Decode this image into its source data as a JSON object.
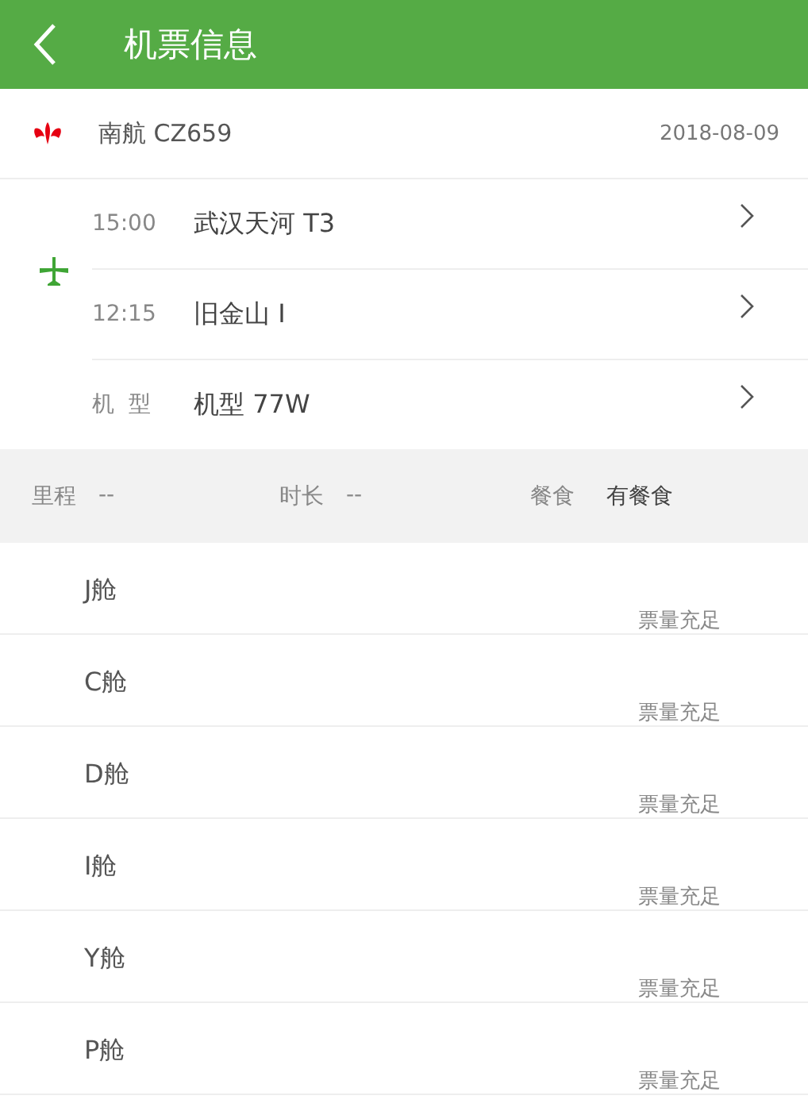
{
  "header": {
    "title": "机票信息"
  },
  "flight": {
    "airline": "南航 CZ659",
    "date": "2018-08-09"
  },
  "route": [
    {
      "label": "15:00",
      "value": "武汉天河 T3"
    },
    {
      "label": "12:15",
      "value": "旧金山 I"
    },
    {
      "label": "机  型",
      "value": "机型 77W"
    }
  ],
  "info": [
    {
      "label": "里程",
      "value": "--"
    },
    {
      "label": "时长",
      "value": "--"
    },
    {
      "label": "餐食",
      "value": "有餐食"
    }
  ],
  "cabins": [
    {
      "name": "J舱",
      "status": "票量充足"
    },
    {
      "name": "C舱",
      "status": "票量充足"
    },
    {
      "name": "D舱",
      "status": "票量充足"
    },
    {
      "name": "I舱",
      "status": "票量充足"
    },
    {
      "name": "Y舱",
      "status": "票量充足"
    },
    {
      "name": "P舱",
      "status": "票量充足"
    }
  ]
}
